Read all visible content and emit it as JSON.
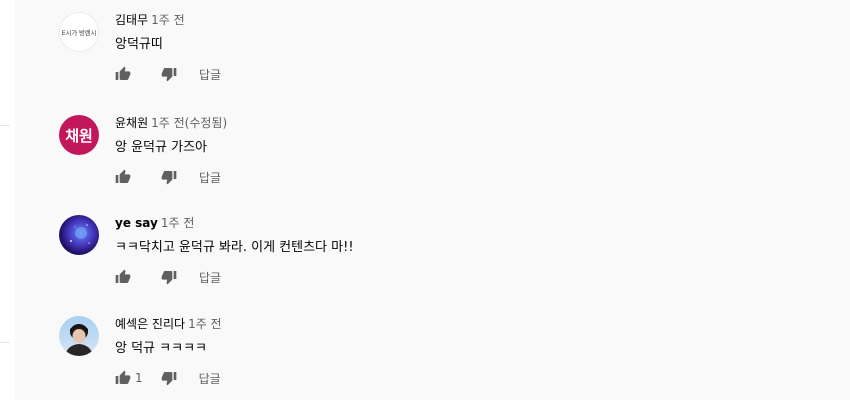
{
  "comments": [
    {
      "author": "김태무",
      "time": "1주 전",
      "text": "앙덕규띠",
      "like_count": "",
      "reply_label": "답글",
      "avatar": {
        "type": "text-logo",
        "text": "E시가 방랜시"
      }
    },
    {
      "author": "윤채원",
      "time": "1주 전(수정됨)",
      "text": "앙 윤덕규 가즈아",
      "like_count": "",
      "reply_label": "답글",
      "avatar": {
        "type": "letter",
        "text": "채원",
        "color": "#c2185b"
      }
    },
    {
      "author": "ye say",
      "time": "1주 전",
      "text": "ㅋㅋ닥치고 윤덕규 봐라. 이게 컨텐츠다 마!!",
      "like_count": "",
      "reply_label": "답글",
      "avatar": {
        "type": "image",
        "description": "night-sky"
      }
    },
    {
      "author": "예섹은 진리다",
      "time": "1주 전",
      "text": "앙 덕규 ㅋㅋㅋㅋ",
      "like_count": "1",
      "reply_label": "답글",
      "avatar": {
        "type": "image",
        "description": "photo"
      }
    }
  ],
  "icons": {
    "like": "thumb-up-icon",
    "dislike": "thumb-down-icon"
  },
  "colors": {
    "panel_bg": "#f9f9f9",
    "text_primary": "#030303",
    "text_secondary": "#606060",
    "icon": "#606060"
  }
}
